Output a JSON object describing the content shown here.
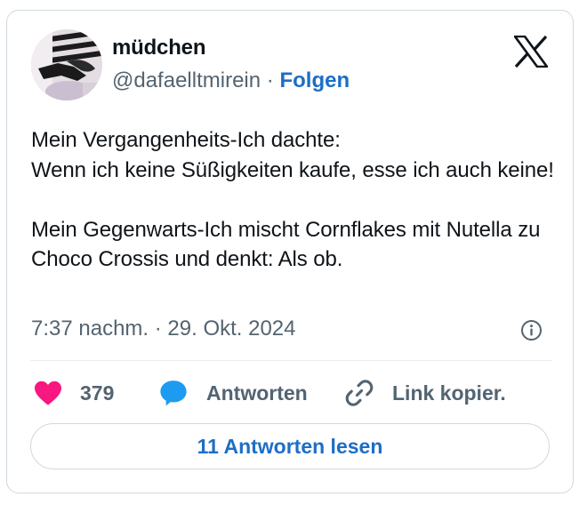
{
  "author": {
    "name": "müdchen",
    "handle": "@dafaelltmirein",
    "separator": "·",
    "follow_label": "Folgen"
  },
  "brand": {
    "logo_icon": "x-logo-icon"
  },
  "tweet": {
    "text": "Mein Vergangenheits-Ich dachte:\nWenn ich keine Süßigkeiten kaufe, esse ich auch keine!\n\nMein Gegenwarts-Ich mischt Cornflakes mit Nutella zu Choco Crossis und denkt: Als ob.",
    "timestamp": "7:37 nachm. · 29. Okt. 2024"
  },
  "actions": {
    "like_count": "379",
    "reply_label": "Antworten",
    "copy_label": "Link kopier."
  },
  "read_replies_label": "11 Antworten lesen",
  "colors": {
    "like": "#f91880",
    "reply": "#1d9bf0",
    "link": "#1d6ec6",
    "muted": "#536471"
  }
}
